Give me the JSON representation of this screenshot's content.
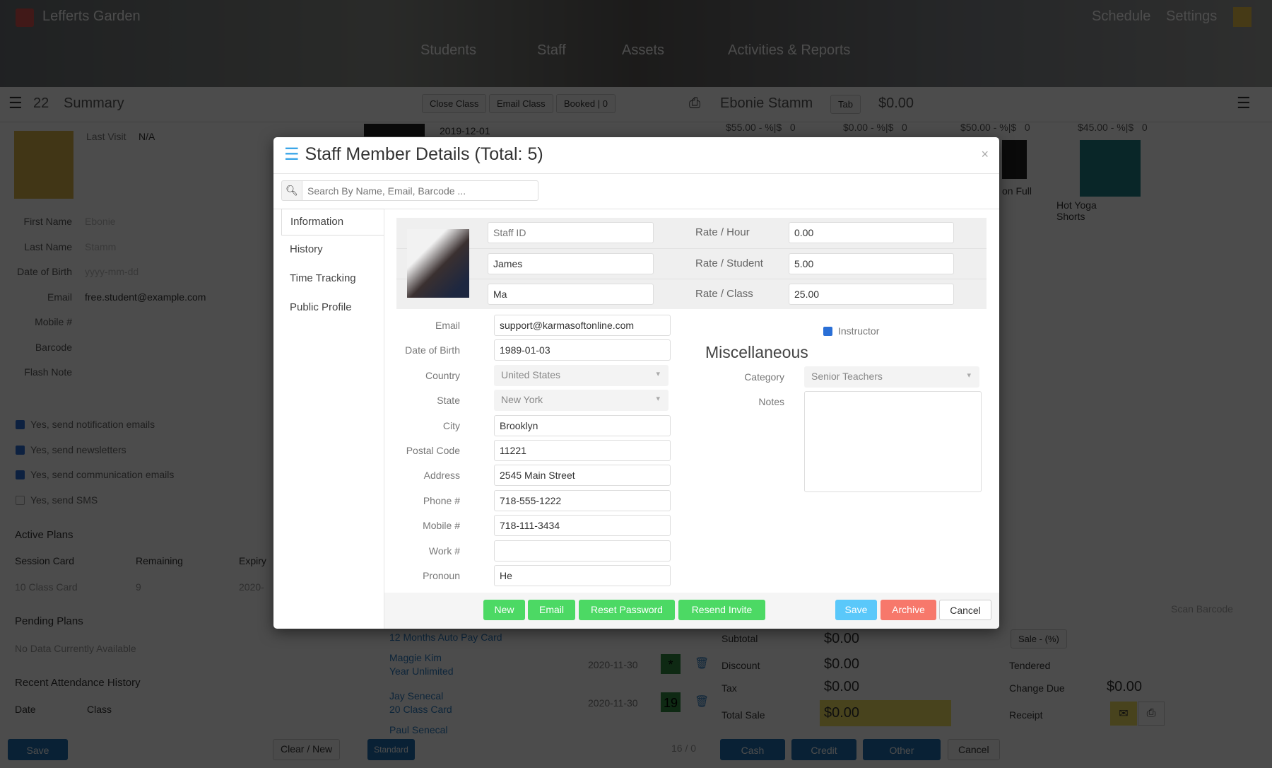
{
  "header": {
    "location": "Lefferts Garden",
    "schedule": "Schedule",
    "settings": "Settings",
    "nav": [
      "Students",
      "Staff",
      "Assets",
      "Activities & Reports"
    ]
  },
  "toolbar": {
    "count": "22",
    "summary": "Summary",
    "close_class": "Close Class",
    "email_class": "Email Class",
    "booked": "Booked | 0",
    "customer": "Ebonie Stamm",
    "tab": "Tab",
    "balance": "$0.00"
  },
  "student": {
    "last_visit_label": "Last Visit",
    "last_visit": "N/A",
    "fields": [
      {
        "label": "First Name",
        "value": "Ebonie"
      },
      {
        "label": "Last Name",
        "value": "Stamm"
      },
      {
        "label": "Date of Birth",
        "value": "yyyy-mm-dd"
      },
      {
        "label": "Email",
        "value": "free.student@example.com"
      },
      {
        "label": "Mobile #",
        "value": ""
      },
      {
        "label": "Barcode",
        "value": ""
      },
      {
        "label": "Flash Note",
        "value": ""
      }
    ],
    "options": [
      {
        "label": "Yes, send notification emails",
        "checked": true
      },
      {
        "label": "Yes, send newsletters",
        "checked": true
      },
      {
        "label": "Yes, send communication emails",
        "checked": true
      },
      {
        "label": "Yes, send SMS",
        "checked": false
      }
    ],
    "active_plans": "Active Plans",
    "plan_headers": [
      "Session Card",
      "Remaining",
      "Expiry"
    ],
    "plan_row": [
      "10 Class Card",
      "9",
      "2020-"
    ],
    "pending_plans": "Pending Plans",
    "no_data": "No Data Currently Available",
    "attendance": "Recent Attendance History",
    "att_headers": [
      "Date",
      "Class"
    ],
    "save": "Save",
    "clear_new": "Clear / New"
  },
  "class_list": {
    "date": "2019-12-01",
    "items": [
      {
        "name": "12 Months Auto Pay Card",
        "plan": "",
        "date": "",
        "badge": ""
      },
      {
        "name": "Maggie Kim",
        "plan": "Year Unlimited",
        "date": "2020-11-30",
        "badge": "*"
      },
      {
        "name": "Jay Senecal",
        "plan": "20 Class Card",
        "date": "2020-11-30",
        "badge": "19"
      },
      {
        "name": "Paul Senecal",
        "plan": "",
        "date": "",
        "badge": ""
      }
    ],
    "standard": "Standard",
    "count": "16 / 0"
  },
  "pos": {
    "prices": [
      {
        "price": "$55.00",
        "disc": "- %|$",
        "qty": "0"
      },
      {
        "price": "$0.00",
        "disc": "- %|$",
        "qty": "0"
      },
      {
        "price": "$50.00",
        "disc": "- %|$",
        "qty": "0"
      },
      {
        "price": "$45.00",
        "disc": "- %|$",
        "qty": "0"
      }
    ],
    "products": [
      "on Full",
      "Hot Yoga Shorts"
    ],
    "scan_barcode": "Scan Barcode",
    "subtotal_label": "Subtotal",
    "subtotal": "$0.00",
    "discount_label": "Discount",
    "discount": "$0.00",
    "tax_label": "Tax",
    "tax": "$0.00",
    "total_label": "Total Sale",
    "total": "$0.00",
    "sale_pct": "Sale - (%)",
    "tendered": "Tendered",
    "change_due_label": "Change Due",
    "change_due": "$0.00",
    "receipt": "Receipt",
    "cash": "Cash",
    "credit": "Credit",
    "other": "Other",
    "cancel": "Cancel"
  },
  "modal": {
    "title": "Staff Member Details (Total: 5)",
    "close": "×",
    "search_placeholder": "Search By Name, Email, Barcode ...",
    "tabs": [
      "Information",
      "History",
      "Time Tracking",
      "Public Profile"
    ],
    "staff_id_placeholder": "Staff ID",
    "first_name": "James",
    "last_name": "Ma",
    "rates": [
      {
        "label": "Rate / Hour",
        "value": "0.00"
      },
      {
        "label": "Rate / Student",
        "value": "5.00"
      },
      {
        "label": "Rate / Class",
        "value": "25.00"
      }
    ],
    "fields": [
      {
        "label": "Email",
        "value": "support@karmasoftonline.com"
      },
      {
        "label": "Date of Birth",
        "value": "1989-01-03"
      },
      {
        "label": "Country",
        "value": "United States"
      },
      {
        "label": "State",
        "value": "New York"
      },
      {
        "label": "City",
        "value": "Brooklyn"
      },
      {
        "label": "Postal Code",
        "value": "11221"
      },
      {
        "label": "Address",
        "value": "2545 Main Street"
      },
      {
        "label": "Phone #",
        "value": "718-555-1222"
      },
      {
        "label": "Mobile #",
        "value": "718-111-3434"
      },
      {
        "label": "Work #",
        "value": ""
      },
      {
        "label": "Pronoun",
        "value": "He"
      }
    ],
    "instructor_label": "Instructor",
    "instructor_checked": true,
    "misc_heading": "Miscellaneous",
    "category_label": "Category",
    "category": "Senior Teachers",
    "notes_label": "Notes",
    "notes": "",
    "buttons": {
      "new": "New",
      "email": "Email",
      "reset_password": "Reset Password",
      "resend_invite": "Resend Invite",
      "save": "Save",
      "archive": "Archive",
      "cancel": "Cancel"
    },
    "colors": {
      "green": "#4cd964",
      "blue": "#5ac8fa",
      "red": "#f7786b"
    }
  }
}
